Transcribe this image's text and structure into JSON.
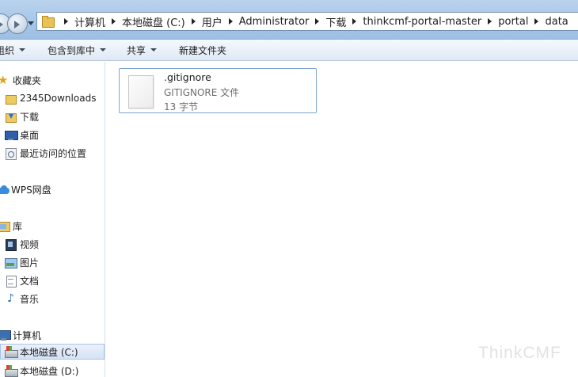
{
  "address_bar": {
    "breadcrumbs": [
      "计算机",
      "本地磁盘 (C:)",
      "用户",
      "Administrator",
      "下载",
      "thinkcmf-portal-master",
      "portal",
      "data"
    ]
  },
  "toolbar": {
    "organize": "组织",
    "include_in_library": "包含到库中",
    "share": "共享",
    "new_folder": "新建文件夹"
  },
  "nav": {
    "favorites": "收藏夹",
    "downloads_2345": "2345Downloads",
    "downloads": "下载",
    "desktop": "桌面",
    "recent": "最近访问的位置",
    "wps": "WPS网盘",
    "libraries": "库",
    "videos": "视频",
    "pictures": "图片",
    "documents": "文档",
    "music": "音乐",
    "computer": "计算机",
    "drive_c": "本地磁盘 (C:)",
    "drive_d": "本地磁盘 (D:)"
  },
  "files": [
    {
      "name": ".gitignore",
      "type": "GITIGNORE 文件",
      "size": "13 字节"
    }
  ],
  "watermark": "ThinkCMF"
}
